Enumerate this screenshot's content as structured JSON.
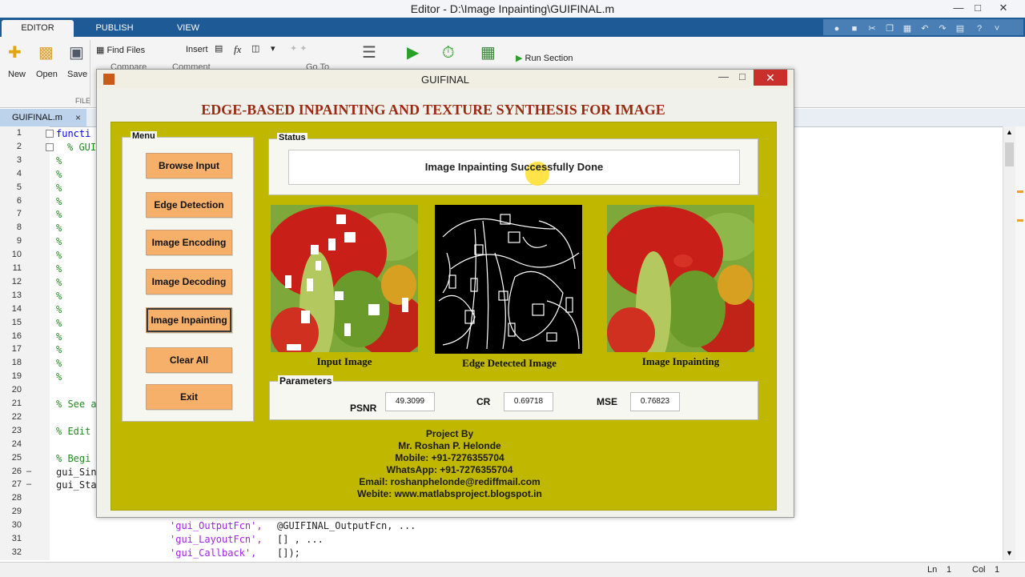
{
  "editor": {
    "window_title": "Editor - D:\\Image Inpainting\\GUIFINAL.m",
    "tabs": [
      "EDITOR",
      "PUBLISH",
      "VIEW"
    ],
    "ribbon": {
      "new": "New",
      "open": "Open",
      "save": "Save",
      "find_files": "Find Files",
      "compare": "Compare",
      "insert": "Insert",
      "comment": "Comment",
      "go_to": "Go To",
      "run_section": "Run Section",
      "file_section": "FILE",
      "fx": "fx"
    },
    "doc_tab": "GUIFINAL.m",
    "doc_close": "×",
    "line_numbers": [
      "1",
      "2",
      "3",
      "4",
      "5",
      "6",
      "7",
      "8",
      "9",
      "10",
      "11",
      "12",
      "13",
      "14",
      "15",
      "16",
      "17",
      "18",
      "19",
      "20",
      "21",
      "22",
      "23",
      "24",
      "25",
      "26",
      "27",
      "28",
      "29",
      "30",
      "31",
      "32"
    ],
    "breakpoint_dash": "–",
    "code": {
      "l1": "functi",
      "l2": "% GUIF",
      "pct": "%",
      "l21": "% See a",
      "l23": "% Edit",
      "l25": "% Begi",
      "l26": "gui_Sin",
      "l27": "gui_Sta",
      "l30_key": "'gui_OutputFcn',",
      "l30_val": "@GUIFINAL_OutputFcn, ...",
      "l31_key": "'gui_LayoutFcn',",
      "l31_val": "[] , ...",
      "l32_key": "'gui_Callback',",
      "l32_val": "[]);"
    },
    "status_ln_label": "Ln",
    "status_ln": "1",
    "status_col_label": "Col",
    "status_col": "1"
  },
  "gui": {
    "title": "GUIFINAL",
    "heading": "EDGE-BASED INPAINTING AND TEXTURE SYNTHESIS FOR IMAGE",
    "menu_title": "Menu",
    "menu_buttons": [
      "Browse Input",
      "Edge Detection",
      "Image Encoding",
      "Image Decoding",
      "Image Inpainting",
      "Clear All",
      "Exit"
    ],
    "status_title": "Status",
    "status_text": "Image Inpainting Successfully Done",
    "captions": {
      "input": "Input Image",
      "edge": "Edge Detected Image",
      "output": "Image Inpainting"
    },
    "params_title": "Parameters",
    "params": {
      "psnr_label": "PSNR",
      "psnr_value": "49.3099",
      "cr_label": "CR",
      "cr_value": "0.69718",
      "mse_label": "MSE",
      "mse_value": "0.76823"
    },
    "credits": [
      "Project By",
      "Mr. Roshan P. Helonde",
      "Mobile: +91-7276355704",
      "WhatsApp: +91-7276355704",
      "Email: roshanphelonde@rediffmail.com",
      "Webite: www.matlabsproject.blogspot.in"
    ]
  },
  "colors": {
    "ribbon_blue": "#1e5a96",
    "panel_olive": "#c0b800",
    "button_orange": "#f7b06a",
    "heading_red": "#9b2a12"
  }
}
